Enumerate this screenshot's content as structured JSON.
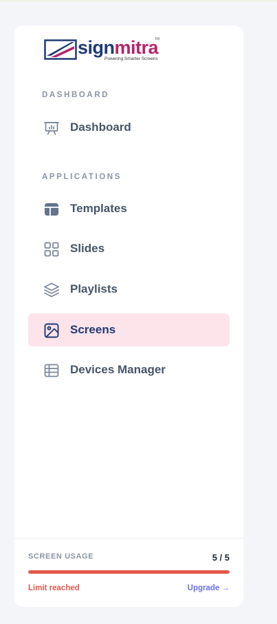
{
  "brand": {
    "name_part1": "sign",
    "name_part2": "mitra",
    "trademark": "tm",
    "tagline": "Powering Smarter Screens",
    "colors": {
      "primary": "#1f3b73",
      "secondary": "#b3256a"
    }
  },
  "sections": {
    "dashboard": "DASHBOARD",
    "applications": "APPLICATIONS"
  },
  "nav": {
    "dashboard": {
      "label": "Dashboard",
      "icon": "presentation-chart-icon"
    },
    "templates": {
      "label": "Templates",
      "icon": "layout-template-icon"
    },
    "slides": {
      "label": "Slides",
      "icon": "grid-squares-icon"
    },
    "playlists": {
      "label": "Playlists",
      "icon": "layers-icon"
    },
    "screens": {
      "label": "Screens",
      "icon": "image-icon",
      "active": true
    },
    "devices": {
      "label": "Devices Manager",
      "icon": "table-list-icon"
    }
  },
  "usage": {
    "label": "SCREEN USAGE",
    "count": "5 / 5",
    "used_fraction": 1.0,
    "status": "Limit reached",
    "upgrade": "Upgrade →",
    "colors": {
      "bar": "#e4574b",
      "link": "#6a6ff0"
    }
  }
}
